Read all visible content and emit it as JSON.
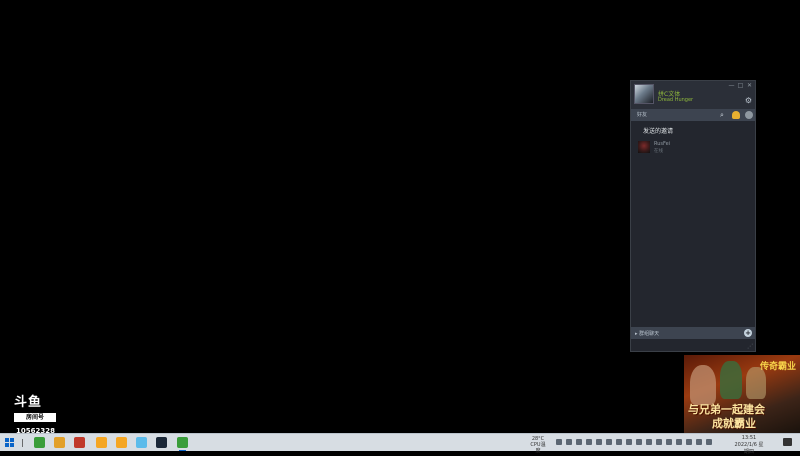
{
  "steam_friends": {
    "window_controls": [
      "—",
      "□",
      "✕"
    ],
    "user": {
      "name": "拼C文体",
      "game": "Dread Hunger"
    },
    "search_label": "好友",
    "section_title": "发送的邀请",
    "friends": [
      {
        "name": "RusFei",
        "status": "在线"
      }
    ],
    "group_chats_label": "群组聊天",
    "icons": [
      "settings-gear-icon",
      "search-icon",
      "hand-icon",
      "add-friend-icon",
      "add-icon"
    ]
  },
  "ad": {
    "logo_text": "传奇霸业",
    "line1": "与兄弟一起建会",
    "line2": "成就霸业"
  },
  "watermark": {
    "logo": "斗鱼",
    "room_label": "房间号",
    "room_id": "10562328"
  },
  "taskbar": {
    "temperature": "28°C",
    "temp_label": "CPU温度",
    "time": "13:51",
    "date": "2022/1/6 星期四",
    "app_colors": [
      "#3a9d3a",
      "#e2a02a",
      "#c0392b",
      "#f5a623",
      "#f5a623",
      "#5bbbea",
      "#1b2838"
    ]
  }
}
